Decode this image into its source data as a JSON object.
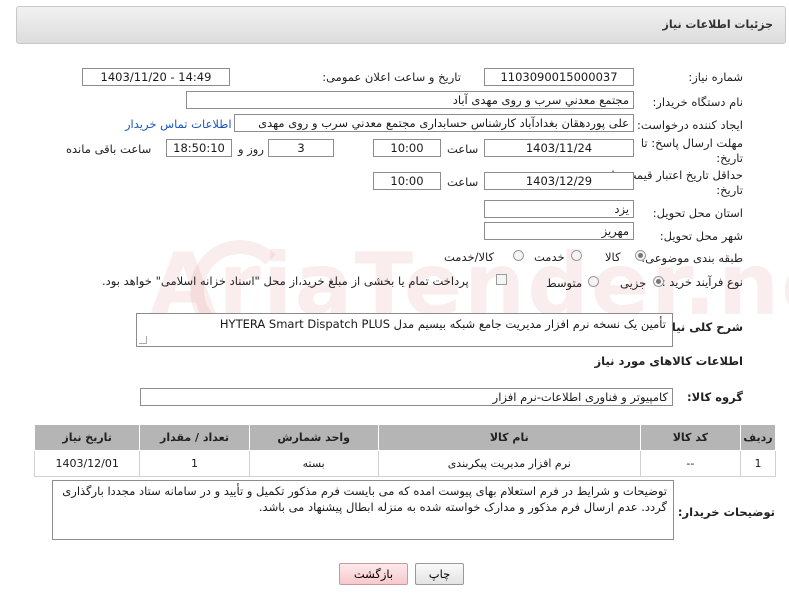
{
  "header": {
    "title": "جزئیات اطلاعات نیاز"
  },
  "form": {
    "need_number": {
      "label": "شماره نیاز:",
      "value": "1103090015000037"
    },
    "announce_datetime": {
      "label": "تاریخ و ساعت اعلان عمومی:",
      "value": "1403/11/20 - 14:49"
    },
    "buyer_org": {
      "label": "نام دستگاه خریدار:",
      "value": "مجتمع معدني سرب و روی مهدی آباد"
    },
    "creator": {
      "label": "ایجاد کننده درخواست:",
      "value": "علی پوردهقان بغدادآباد کارشناس حسابداری مجتمع معدني سرب و روی مهدی",
      "contact_link": "اطلاعات تماس خریدار"
    },
    "reply_deadline": {
      "label_line1": "مهلت ارسال پاسخ: تا",
      "label_line2": "تاریخ:",
      "date": "1403/11/24",
      "time_label": "ساعت",
      "time": "10:00",
      "days": "3",
      "days_label": "روز و",
      "remaining": "18:50:10",
      "remaining_label": "ساعت باقی مانده"
    },
    "price_validity": {
      "label_line1": "حداقل تاریخ اعتبار قیمت: تا",
      "label_line2": "تاریخ:",
      "date": "1403/12/29",
      "time_label": "ساعت",
      "time": "10:00"
    },
    "province": {
      "label": "استان محل تحویل:",
      "value": "یزد"
    },
    "city": {
      "label": "شهر محل تحویل:",
      "value": "مهریز"
    },
    "category": {
      "label": "طبقه بندی موضوعی:",
      "options": [
        "کالا",
        "خدمت",
        "کالا/خدمت"
      ],
      "selected": "کالا"
    },
    "purchase_type": {
      "label": "نوع فرآیند خرید :",
      "options": [
        "جزیی",
        "متوسط"
      ],
      "selected": "جزیی",
      "payment_note": "پرداخت تمام یا بخشی از مبلغ خرید،از محل \"اسناد خزانه اسلامی\" خواهد بود."
    },
    "description": {
      "label": "شرح کلی نیاز:",
      "value": "تأمین یک نسخه نرم افزار مدیریت جامع شبکه بیسیم مدل HYTERA Smart Dispatch PLUS"
    }
  },
  "goods": {
    "section_title": "اطلاعات کالاهای مورد نیاز",
    "group_label": "گروه کالا:",
    "group_value": "کامپیوتر و فناوری اطلاعات-نرم افزار",
    "columns": [
      "ردیف",
      "کد کالا",
      "نام کالا",
      "واحد شمارش",
      "تعداد / مقدار",
      "تاریخ نیاز"
    ],
    "rows": [
      {
        "row": "1",
        "code": "--",
        "name": "نرم افزار مدیریت پیکربندی",
        "unit": "بسته",
        "qty": "1",
        "date": "1403/12/01"
      }
    ]
  },
  "buyer_notes": {
    "label": "توضیحات خریدار:",
    "value": "توضیحات و شرایط در فرم استعلام بهای پیوست امده که می بایست فرم مذکور تکمیل و تأیید و در سامانه ستاد مجددا بارگذاری گردد. عدم ارسال فرم  مذکور و مدارک خواسته شده به منزله ابطال پیشنهاد می باشد."
  },
  "buttons": {
    "print": "چاپ",
    "back": "بازگشت"
  },
  "watermark": {
    "text": "AriaTender.neT"
  }
}
